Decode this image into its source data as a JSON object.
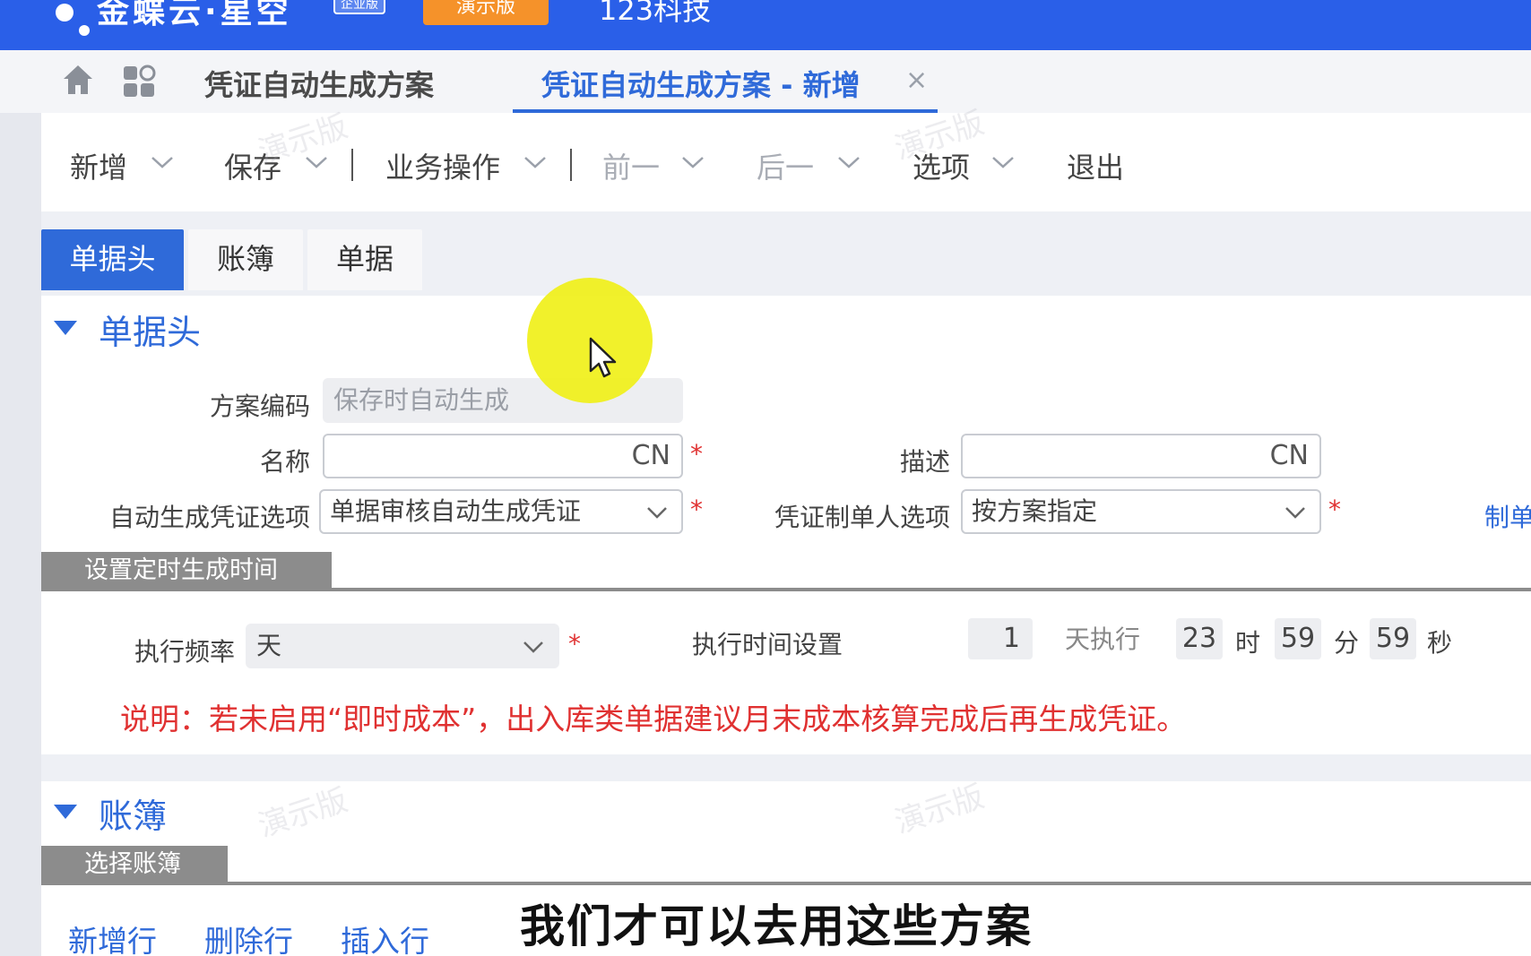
{
  "app": {
    "brand": "金蝶云·星空",
    "edition": "企业版",
    "demo_badge": "演示版",
    "company": "123科技"
  },
  "tabs": [
    {
      "label": "凭证自动生成方案",
      "active": false
    },
    {
      "label": "凭证自动生成方案 - 新增",
      "active": true
    }
  ],
  "toolbar": {
    "new": "新增",
    "save": "保存",
    "business_ops": "业务操作",
    "prev": "前一",
    "next": "后一",
    "options": "选项",
    "exit": "退出"
  },
  "detail_tabs": [
    "单据头",
    "账簿",
    "单据"
  ],
  "header_section": {
    "title": "单据头",
    "scheme_code": {
      "label": "方案编码",
      "value": "保存时自动生成"
    },
    "name": {
      "label": "名称",
      "value": "",
      "suffix": "CN"
    },
    "description": {
      "label": "描述",
      "value": "",
      "suffix": "CN"
    },
    "auto_option": {
      "label": "自动生成凭证选项",
      "value": "单据审核自动生成凭证"
    },
    "maker_option": {
      "label": "凭证制单人选项",
      "value": "按方案指定"
    },
    "maker_link": "制单",
    "required_mark": "*"
  },
  "schedule": {
    "subheader": "设置定时生成时间",
    "frequency": {
      "label": "执行频率",
      "value": "天"
    },
    "time_setting_label": "执行时间设置",
    "day_value": "1",
    "day_unit": "天执行",
    "hour": "23",
    "hour_unit": "时",
    "minute": "59",
    "minute_unit": "分",
    "second": "59",
    "second_unit": "秒",
    "note": "说明：若未启用“即时成本”，出入库类单据建议月末成本核算完成后再生成凭证。"
  },
  "ledger_section": {
    "title": "账簿",
    "subheader": "选择账簿",
    "actions": [
      "新增行",
      "删除行",
      "插入行"
    ]
  },
  "watermark": "演示版",
  "subtitle": "我们才可以去用这些方案",
  "colors": {
    "primary": "#2f6ad9",
    "topbar": "#2a5fe8",
    "demo_badge": "#f5922a",
    "required": "#e03131",
    "cursor_highlight": "#f0f014"
  }
}
